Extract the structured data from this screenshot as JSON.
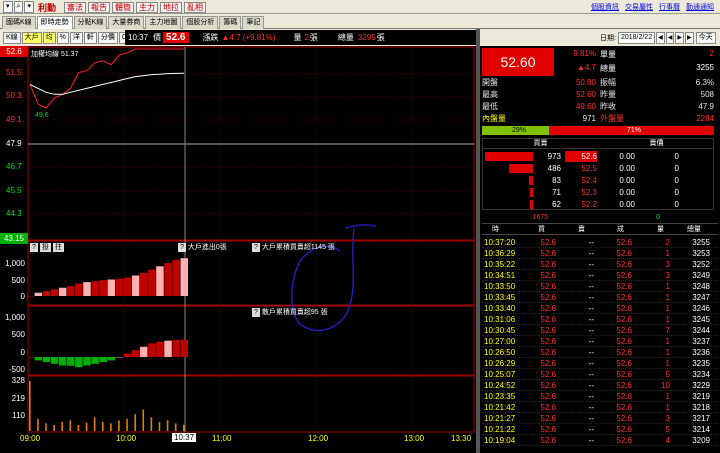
{
  "app": {
    "title": "利勤",
    "search_glyph": "⌕"
  },
  "menu": [
    {
      "label": "審法"
    },
    {
      "label": "報告"
    },
    {
      "label": "體簡"
    },
    {
      "label": "主力"
    },
    {
      "label": "地拉"
    },
    {
      "label": "亂相"
    }
  ],
  "links": [
    {
      "label": "個股資訊"
    },
    {
      "label": "交易屬性"
    },
    {
      "label": "行事曆"
    },
    {
      "label": "勤通通知"
    }
  ],
  "tabs": [
    {
      "label": "國碼K線"
    },
    {
      "label": "即時走勢",
      "active": true
    },
    {
      "label": "分點K線"
    },
    {
      "label": "大量券商"
    },
    {
      "label": "主力地圖"
    },
    {
      "label": "個股分析"
    },
    {
      "label": "籌碼"
    },
    {
      "label": "筆記"
    }
  ],
  "subtoolbar": {
    "buttons": [
      {
        "label": "K線"
      },
      {
        "label": "大戶",
        "active": true
      },
      {
        "label": "均",
        "active": true
      },
      {
        "label": "%"
      },
      {
        "label": "洋"
      },
      {
        "label": "軒"
      },
      {
        "label": "分價"
      },
      {
        "label": "CDP"
      }
    ],
    "time": "10:37",
    "price_label": "價",
    "price": "52.6",
    "change_label": "漲跌",
    "change": "▲4.7 (+9.81%)",
    "vol_label": "量",
    "vol": "2",
    "vol_unit": "張",
    "total_label": "總量",
    "total": "3295",
    "total_unit": "張"
  },
  "price_chart": {
    "legend": "加權均線 51.37",
    "y_labels": [
      "52.6",
      "51.5",
      "50.3",
      "49.1",
      "47.9",
      "46.7",
      "45.5",
      "44.3",
      "43.15"
    ],
    "low_label": "49.6"
  },
  "panel2": {
    "buttons": [
      "?",
      "投",
      "拄"
    ],
    "title1": "大戶進出0張",
    "title2": "大戶累積買賣超1145 張",
    "y_labels": [
      "1,000",
      "500",
      "0"
    ]
  },
  "panel3": {
    "title": "散戶累積買賣超95 張",
    "y_labels": [
      "1,000",
      "500",
      "0",
      "-500"
    ]
  },
  "panel4": {
    "y_labels": [
      "328",
      "219",
      "110"
    ]
  },
  "time_axis": {
    "labels": [
      "09:00",
      "10:00",
      "10:37",
      "11:00",
      "12:00",
      "13:00",
      "13:30"
    ]
  },
  "date": {
    "label": "日期:",
    "value": "2018/2/22",
    "today": "今天",
    "nav": [
      "◀",
      "◀",
      "▶",
      "▶"
    ]
  },
  "quote": {
    "price": "52.60",
    "pct": "9.81%",
    "chg": "▲4.7",
    "single_label": "單量",
    "single": "2",
    "total_label": "總量",
    "total": "3255",
    "rows": [
      {
        "l1": "開盤",
        "v1": "50.80",
        "l2": "振幅",
        "v2": "6.3%"
      },
      {
        "l1": "最高",
        "v1": "52.60",
        "l2": "昨量",
        "v2": "508"
      },
      {
        "l1": "最低",
        "v1": "49.60",
        "l2": "昨收",
        "v2": "47.9"
      }
    ],
    "inner_label": "內盤量",
    "inner": "971",
    "outer_label": "外盤量",
    "outer": "2284",
    "inner_pct": "29%",
    "outer_pct": "71%",
    "inner_ratio": 0.29
  },
  "orderbook": {
    "bid_header": "買賣",
    "ask_header": "賣價",
    "bids": [
      {
        "vol": "973",
        "price": "52.6",
        "ratio": 1.0
      },
      {
        "vol": "486",
        "price": "52.5",
        "ratio": 0.5
      },
      {
        "vol": "83",
        "price": "52.4",
        "ratio": 0.09
      },
      {
        "vol": "71",
        "price": "52.3",
        "ratio": 0.07
      },
      {
        "vol": "62",
        "price": "52.2",
        "ratio": 0.06
      }
    ],
    "asks": [
      {
        "price": "0.00",
        "vol": "0"
      },
      {
        "price": "0.00",
        "vol": "0"
      },
      {
        "price": "0.00",
        "vol": "0"
      },
      {
        "price": "0.00",
        "vol": "0"
      },
      {
        "price": "0.00",
        "vol": "0"
      }
    ],
    "bid_total": "1675",
    "ask_total": "0"
  },
  "ticks_header": {
    "time": "時",
    "bid": "買",
    "ask": "賣",
    "deal": "成",
    "vol": "量",
    "total": "總量"
  },
  "ticks": [
    {
      "t": "10:37:20",
      "b": "52.6",
      "a": "--",
      "d": "52.6",
      "v": "2",
      "tot": "3255"
    },
    {
      "t": "10:36:29",
      "b": "52.6",
      "a": "--",
      "d": "52.6",
      "v": "1",
      "tot": "3253"
    },
    {
      "t": "10:35:22",
      "b": "52.6",
      "a": "--",
      "d": "52.6",
      "v": "3",
      "tot": "3252"
    },
    {
      "t": "10:34:51",
      "b": "52.6",
      "a": "--",
      "d": "52.6",
      "v": "3",
      "tot": "3249"
    },
    {
      "t": "10:33:50",
      "b": "52.6",
      "a": "--",
      "d": "52.6",
      "v": "1",
      "tot": "3248"
    },
    {
      "t": "10:33:45",
      "b": "52.6",
      "a": "--",
      "d": "52.6",
      "v": "1",
      "tot": "3247"
    },
    {
      "t": "10:33:40",
      "b": "52.6",
      "a": "--",
      "d": "52.6",
      "v": "1",
      "tot": "3246"
    },
    {
      "t": "10:31:06",
      "b": "52.6",
      "a": "--",
      "d": "52.6",
      "v": "1",
      "tot": "3245"
    },
    {
      "t": "10:30:45",
      "b": "52.6",
      "a": "--",
      "d": "52.6",
      "v": "7",
      "tot": "3244"
    },
    {
      "t": "10:27:00",
      "b": "52.6",
      "a": "--",
      "d": "52.6",
      "v": "1",
      "tot": "3237"
    },
    {
      "t": "10:26:50",
      "b": "52.6",
      "a": "--",
      "d": "52.6",
      "v": "1",
      "tot": "3236"
    },
    {
      "t": "10:26:29",
      "b": "52.6",
      "a": "--",
      "d": "52.6",
      "v": "1",
      "tot": "3235"
    },
    {
      "t": "10:25:07",
      "b": "52.6",
      "a": "--",
      "d": "52.6",
      "v": "5",
      "tot": "3234"
    },
    {
      "t": "10:24:52",
      "b": "52.6",
      "a": "--",
      "d": "52.6",
      "v": "10",
      "tot": "3229"
    },
    {
      "t": "10:23:35",
      "b": "52.6",
      "a": "--",
      "d": "52.6",
      "v": "1",
      "tot": "3219"
    },
    {
      "t": "10:21:42",
      "b": "52.6",
      "a": "--",
      "d": "52.6",
      "v": "1",
      "tot": "3218"
    },
    {
      "t": "10:21:27",
      "b": "52.6",
      "a": "--",
      "d": "52.6",
      "v": "3",
      "tot": "3217"
    },
    {
      "t": "10:21:22",
      "b": "52.6",
      "a": "--",
      "d": "52.6",
      "v": "5",
      "tot": "3214"
    },
    {
      "t": "10:19:04",
      "b": "52.6",
      "a": "--",
      "d": "52.6",
      "v": "4",
      "tot": "3209"
    }
  ],
  "chart_data": {
    "type": "line",
    "x": [
      "09:00",
      "09:05",
      "09:10",
      "09:15",
      "09:20",
      "09:25",
      "09:30",
      "09:35",
      "09:40",
      "09:45",
      "09:50",
      "09:55",
      "10:00",
      "10:05",
      "10:10",
      "10:15",
      "10:20",
      "10:25",
      "10:30",
      "10:37"
    ],
    "series": [
      {
        "name": "price",
        "values": [
          50.8,
          49.8,
          49.6,
          50.1,
          50.3,
          50.6,
          51.4,
          51.5,
          51.9,
          52.0,
          51.8,
          52.3,
          52.4,
          52.6,
          52.6,
          52.6,
          52.6,
          52.6,
          52.6,
          52.6
        ]
      },
      {
        "name": "加權均線",
        "values": [
          50.8,
          50.6,
          50.4,
          50.3,
          50.3,
          50.4,
          50.5,
          50.6,
          50.7,
          50.8,
          50.9,
          51.0,
          51.1,
          51.2,
          51.25,
          51.3,
          51.32,
          51.35,
          51.36,
          51.37
        ]
      }
    ],
    "big_holder_cumulative": [
      0,
      100,
      150,
      200,
      250,
      300,
      380,
      420,
      450,
      480,
      500,
      520,
      560,
      620,
      700,
      800,
      900,
      1000,
      1100,
      1145
    ],
    "retail_cumulative": [
      0,
      -100,
      -150,
      -200,
      -250,
      -260,
      -300,
      -250,
      -200,
      -150,
      -100,
      0,
      100,
      200,
      300,
      400,
      450,
      480,
      500,
      510
    ],
    "volume": [
      328,
      80,
      50,
      40,
      60,
      70,
      40,
      55,
      90,
      60,
      50,
      70,
      80,
      110,
      140,
      90,
      60,
      70,
      50,
      40
    ],
    "ylim": [
      43.15,
      52.6
    ],
    "reference": 47.9
  }
}
